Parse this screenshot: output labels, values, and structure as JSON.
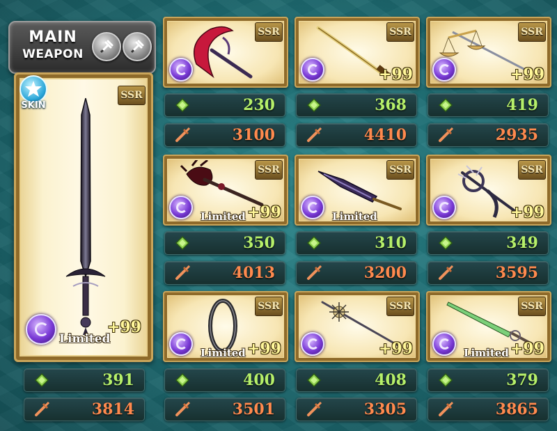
{
  "main_weapon": {
    "title_line1": "MAIN",
    "title_line2": "WEAPON",
    "skin_label": "SKIN",
    "rarity": "SSR",
    "limited_label": "Limited",
    "plus": "+99",
    "hp": "391",
    "atk": "3814",
    "element": "dark"
  },
  "weapons": [
    {
      "rarity": "SSR",
      "plus": "",
      "limited": "",
      "hp": "230",
      "atk": "3100",
      "element": "dark"
    },
    {
      "rarity": "SSR",
      "plus": "+99",
      "limited": "",
      "hp": "368",
      "atk": "4410",
      "element": "dark"
    },
    {
      "rarity": "SSR",
      "plus": "+99",
      "limited": "",
      "hp": "419",
      "atk": "2935",
      "element": "dark"
    },
    {
      "rarity": "SSR",
      "plus": "+99",
      "limited": "Limited",
      "hp": "350",
      "atk": "4013",
      "element": "dark"
    },
    {
      "rarity": "SSR",
      "plus": "",
      "limited": "Limited",
      "hp": "310",
      "atk": "3200",
      "element": "dark"
    },
    {
      "rarity": "SSR",
      "plus": "+99",
      "limited": "",
      "hp": "349",
      "atk": "3595",
      "element": "dark"
    },
    {
      "rarity": "SSR",
      "plus": "+99",
      "limited": "Limited",
      "hp": "400",
      "atk": "3501",
      "element": "dark"
    },
    {
      "rarity": "SSR",
      "plus": "+99",
      "limited": "",
      "hp": "408",
      "atk": "3305",
      "element": "dark"
    },
    {
      "rarity": "SSR",
      "plus": "+99",
      "limited": "Limited",
      "hp": "379",
      "atk": "3865",
      "element": "dark"
    }
  ],
  "colors": {
    "hp_text": "#b6f06a",
    "atk_text": "#ff8a4e",
    "frame_gold": "#caa55a"
  },
  "icons": {
    "hp": "green-diamond-icon",
    "atk": "sword-icon",
    "element": "dark-element-icon",
    "skin": "star-icon"
  }
}
